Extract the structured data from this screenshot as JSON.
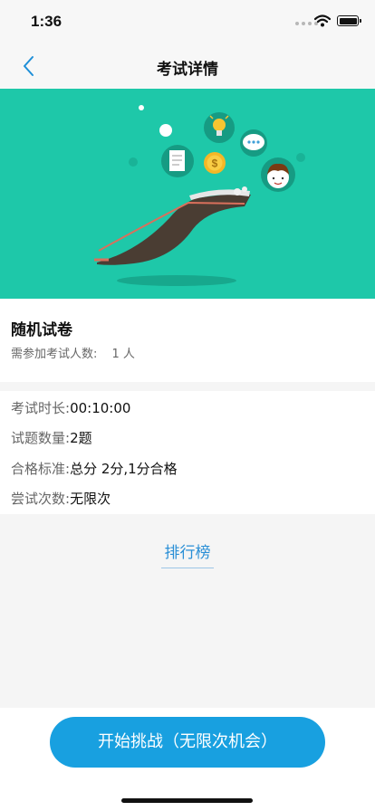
{
  "status_bar": {
    "time": "1:36"
  },
  "nav": {
    "title": "考试详情",
    "back_icon": "chevron-left-icon"
  },
  "exam": {
    "name": "随机试卷",
    "participants_label": "需参加考试人数:",
    "participants_value": "1 人"
  },
  "details": [
    {
      "label": "考试时长:",
      "value": "00:10:00"
    },
    {
      "label": "试题数量:",
      "value": "2题"
    },
    {
      "label": "合格标准:",
      "value": "总分 2分,1分合格"
    },
    {
      "label": "尝试次数:",
      "value": "无限次"
    }
  ],
  "ranking_link": "排行榜",
  "start_button": "开始挑战（无限次机会）",
  "colors": {
    "hero_bg": "#1ec8a9",
    "accent": "#18a0e0",
    "link": "#2a8fd6"
  }
}
